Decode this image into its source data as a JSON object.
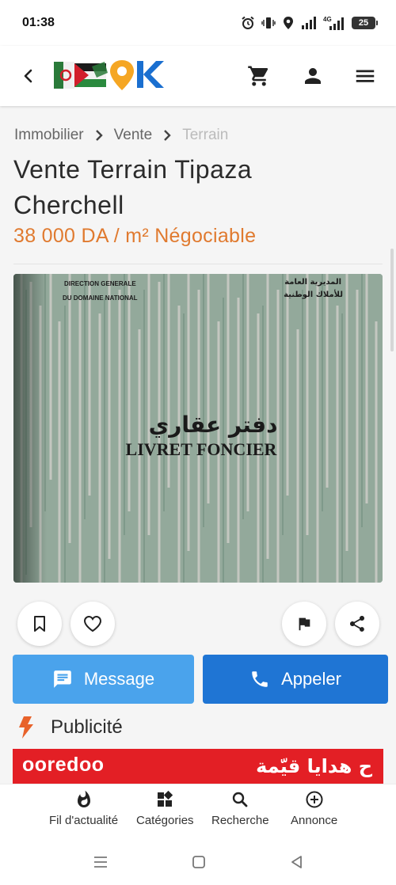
{
  "status_bar": {
    "time": "01:38",
    "network": "4G",
    "battery": "25",
    "icons": [
      "alarm-icon",
      "vibrate-icon",
      "location-icon",
      "signal-icon",
      "signal-4g-icon",
      "battery-icon"
    ]
  },
  "header": {
    "logo_text": "OK",
    "icons": [
      "back-icon",
      "cart-icon",
      "user-icon",
      "menu-icon"
    ]
  },
  "breadcrumb": {
    "items": [
      "Immobilier",
      "Vente",
      "Terrain"
    ]
  },
  "listing": {
    "title": "Vente Terrain Tipaza Cherchell",
    "price": "38 000 DA / m² Négociable",
    "photo": {
      "header_left_line1": "DIRECTION GENERALE",
      "header_left_line2": "DU DOMAINE NATIONAL",
      "header_right_line1": "المديرية العامة",
      "header_right_line2": "للأملاك الوطنية",
      "title_arabic": "دفتر عقاري",
      "title_french": "LIVRET FONCIER"
    }
  },
  "actions": {
    "message_label": "Message",
    "call_label": "Appeler"
  },
  "ad": {
    "label": "Publicité",
    "brand": "ooredoo",
    "text_arabic": "ح هدايا قيّمة"
  },
  "bottom_nav": {
    "items": [
      {
        "label": "Fil d'actualité",
        "icon": "flame-icon"
      },
      {
        "label": "Catégories",
        "icon": "categories-icon"
      },
      {
        "label": "Recherche",
        "icon": "search-icon"
      },
      {
        "label": "Annonce",
        "icon": "add-circle-icon"
      }
    ]
  },
  "colors": {
    "price": "#e07a2f",
    "message_button": "#4aa3ec",
    "call_button": "#1f75d4",
    "ad_banner": "#e31f25",
    "logo_orange": "#f5a623",
    "logo_blue": "#1a6fd0"
  }
}
